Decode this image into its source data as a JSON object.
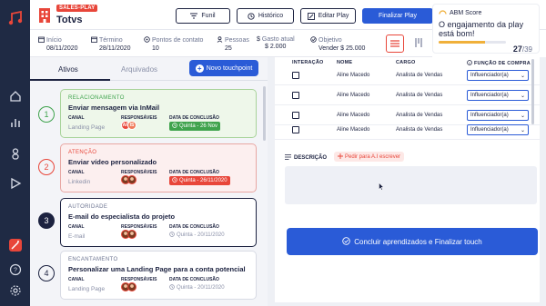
{
  "rail": {
    "icons": [
      "music-logo-icon",
      "home-icon",
      "chart-icon",
      "person-icon",
      "play-icon",
      "magic-icon",
      "help-icon",
      "settings-icon"
    ]
  },
  "header": {
    "tag": "SALES-PLAY",
    "title": "Totvs",
    "buttons": {
      "funil": "Funil",
      "historico": "Histórico",
      "editar": "Editar Play",
      "finalizar": "Finalizar Play"
    }
  },
  "stats": [
    {
      "label": "Início",
      "value": "08/11/2020"
    },
    {
      "label": "Término",
      "value": "28/11/2020"
    },
    {
      "label": "Pontos de contato",
      "value": "10"
    },
    {
      "label": "Pessoas",
      "value": "25"
    },
    {
      "label": "Gasto atual",
      "value": "$ 2.000"
    },
    {
      "label": "Objetivo",
      "value": "Vender $ 25.000"
    }
  ],
  "abm": {
    "title": "ABM Score",
    "message": "O engajamento da play está bom!",
    "score": "27",
    "total": "/39",
    "progress": 0.69
  },
  "left": {
    "tabs": {
      "active": "Ativos",
      "archived": "Arquivados"
    },
    "new_button": "Novo touchpoint",
    "col_labels": {
      "canal": "CANAL",
      "responsaveis": "RESPONSÁVEIS",
      "conclusao": "DATA DE CONCLUSÃO"
    },
    "cards": [
      {
        "step": "1",
        "category": "RELACIONAMENTO",
        "title": "Enviar mensagem via InMail",
        "canal": "Landing Page",
        "date": "Quinta - 26 Nov",
        "avatars": [
          "AF",
          "IS"
        ]
      },
      {
        "step": "2",
        "category": "ATENÇÃO",
        "title": "Enviar vídeo personalizado",
        "canal": "Linkedin",
        "date": "Quinta - 26/11/2020"
      },
      {
        "step": "3",
        "category": "AUTORIDADE",
        "title": "E-mail do especialista do projeto",
        "canal": "E-mail",
        "date": "Quinta - 20/11/2020"
      },
      {
        "step": "4",
        "category": "ENCANTAMENTO",
        "title": "Personalizar uma Landing Page para a conta potencial",
        "canal": "Landing Page",
        "date": "Quinta - 20/11/2020"
      }
    ]
  },
  "right": {
    "table_headers": {
      "interacao": "INTERAÇÃO",
      "nome": "NOME",
      "cargo": "CARGO",
      "funcao": "FUNÇÃO DE COMPRA"
    },
    "rows": [
      {
        "name": "Aline Macedo",
        "role": "Analista de Vendas",
        "function": "Influenciador(a)"
      },
      {
        "name": "Aline Macedo",
        "role": "Analista de Vendas",
        "function": "Influenciador(a)"
      },
      {
        "name": "Aline Macedo",
        "role": "Analista de Vendas",
        "function": "Influenciador(a)"
      },
      {
        "name": "Aline Macedo",
        "role": "Analista de Vendas",
        "function": "Influenciador(a)"
      }
    ],
    "desc_label": "DESCRIÇÃO",
    "ai_button": "Pedir para A.I escrever",
    "finish_button": "Concluir aprendizados e Finalizar touch"
  },
  "colors": {
    "accent": "#2a5bd7",
    "brand": "#e8463a",
    "rail": "#1f2a44",
    "success": "#3fa34d",
    "warning": "#f0b03a"
  }
}
